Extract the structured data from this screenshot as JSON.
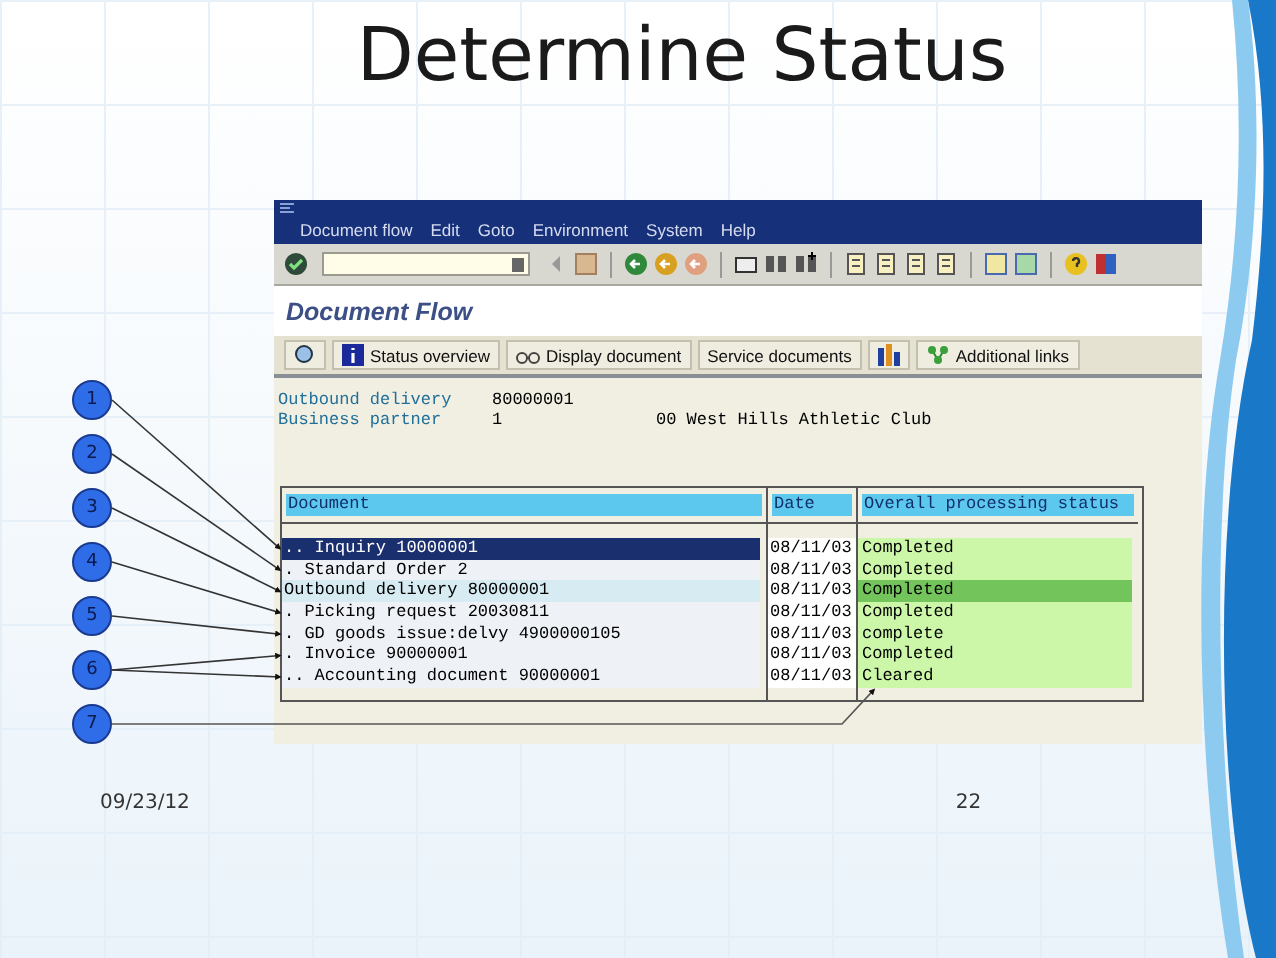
{
  "slide": {
    "title": "Determine Status",
    "date": "09/23/12",
    "page_number": "22"
  },
  "window": {
    "menu": [
      "Document flow",
      "Edit",
      "Goto",
      "Environment",
      "System",
      "Help"
    ],
    "screen_title": "Document Flow",
    "app_toolbar": [
      {
        "kind": "icon"
      },
      {
        "kind": "info",
        "label": "Status overview"
      },
      {
        "kind": "glasses",
        "label": "Display document"
      },
      {
        "kind": "text",
        "label": "Service documents"
      },
      {
        "kind": "icon2"
      },
      {
        "kind": "links",
        "label": "Additional links"
      }
    ],
    "header_fields": [
      {
        "label": "Outbound delivery",
        "value": "80000001"
      },
      {
        "label": "Business partner",
        "value": "1",
        "description": "00 West Hills Athletic Club"
      }
    ],
    "table": {
      "columns": [
        "Document",
        "Date",
        "Overall processing status"
      ],
      "rows": [
        {
          "document": ".. Inquiry 10000001",
          "date": "08/11/03",
          "status": "Completed",
          "selected": true,
          "current": false
        },
        {
          "document": ". Standard Order 2",
          "date": "08/11/03",
          "status": "Completed",
          "selected": false,
          "current": false
        },
        {
          "document": "Outbound delivery 80000001",
          "date": "08/11/03",
          "status": "Completed",
          "selected": false,
          "current": true
        },
        {
          "document": ". Picking request 20030811",
          "date": "08/11/03",
          "status": "Completed",
          "selected": false,
          "current": false
        },
        {
          "document": ". GD goods issue:delvy 4900000105",
          "date": "08/11/03",
          "status": "complete",
          "selected": false,
          "current": false
        },
        {
          "document": ". Invoice 90000001",
          "date": "08/11/03",
          "status": "Completed",
          "selected": false,
          "current": false
        },
        {
          "document": ".. Accounting document 90000001",
          "date": "08/11/03",
          "status": "Cleared",
          "selected": false,
          "current": false
        }
      ]
    }
  },
  "callouts": [
    "1",
    "2",
    "3",
    "4",
    "5",
    "6",
    "7"
  ]
}
